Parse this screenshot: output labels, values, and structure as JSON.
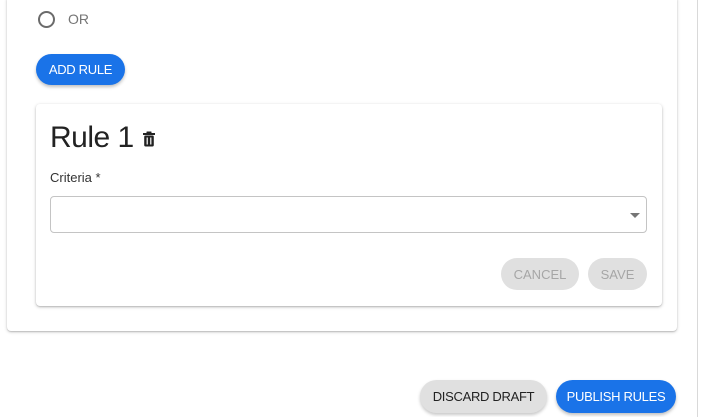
{
  "colors": {
    "primary": "#1a73e8",
    "disabled_bg": "#e0e0e0",
    "disabled_text": "#a6a6a6",
    "text_dark": "#222222",
    "text_muted": "#757575"
  },
  "logic": {
    "option_label": "OR",
    "option_selected": false
  },
  "add_rule_label": "ADD RULE",
  "rule": {
    "title": "Rule 1",
    "delete_icon": "trash-icon",
    "criteria_label": "Criteria *",
    "criteria_value": "",
    "cancel_label": "CANCEL",
    "save_label": "SAVE"
  },
  "footer": {
    "discard_label": "DISCARD DRAFT",
    "publish_label": "PUBLISH RULES"
  }
}
